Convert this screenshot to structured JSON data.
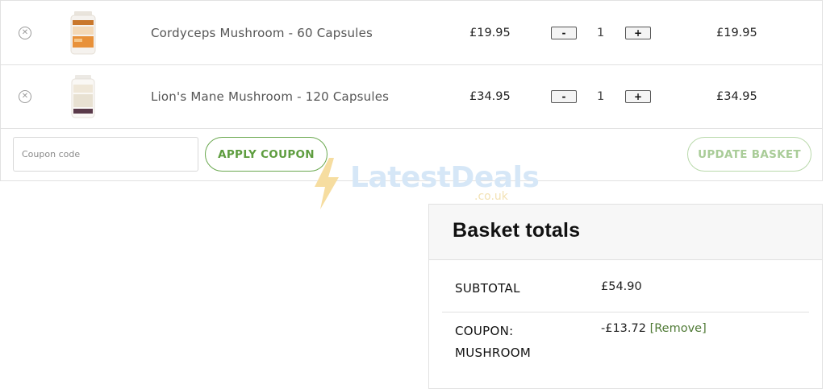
{
  "cart": {
    "items": [
      {
        "name": "Cordyceps Mushroom - 60 Capsules",
        "price": "£19.95",
        "quantity": "1",
        "total": "£19.95",
        "remove_icon": "circle-x-icon"
      },
      {
        "name": "Lion's Mane Mushroom - 120 Capsules",
        "price": "£34.95",
        "quantity": "1",
        "total": "£34.95",
        "remove_icon": "circle-x-icon"
      }
    ],
    "qty_minus_label": "-",
    "qty_plus_label": "+",
    "coupon": {
      "placeholder": "Coupon code",
      "apply_label": "APPLY COUPON",
      "update_label": "UPDATE BASKET"
    }
  },
  "watermark": {
    "text": "LatestDeals",
    "sub": ".co.uk"
  },
  "totals": {
    "title": "Basket totals",
    "subtotal_label": "SUBTOTAL",
    "subtotal_value": "£54.90",
    "coupon_label": "COUPON: MUSHROOM",
    "coupon_value": "-£13.72",
    "coupon_remove": "[Remove]"
  },
  "colors": {
    "accent_green": "#5e9d3f",
    "border": "#e1e1e1"
  }
}
